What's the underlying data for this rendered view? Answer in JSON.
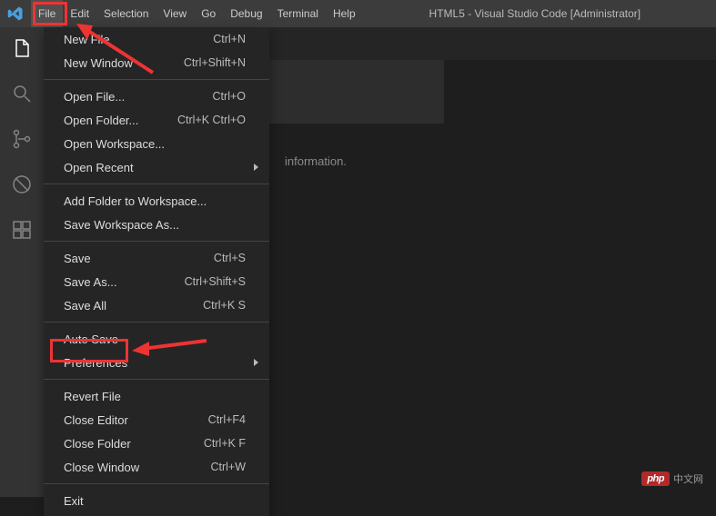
{
  "menubar": {
    "items": [
      {
        "label": "File"
      },
      {
        "label": "Edit"
      },
      {
        "label": "Selection"
      },
      {
        "label": "View"
      },
      {
        "label": "Go"
      },
      {
        "label": "Debug"
      },
      {
        "label": "Terminal"
      },
      {
        "label": "Help"
      }
    ],
    "title": "HTML5 - Visual Studio Code [Administrator]"
  },
  "dropdown": {
    "groups": [
      [
        {
          "label": "New File",
          "kbd": "Ctrl+N"
        },
        {
          "label": "New Window",
          "kbd": "Ctrl+Shift+N"
        }
      ],
      [
        {
          "label": "Open File...",
          "kbd": "Ctrl+O"
        },
        {
          "label": "Open Folder...",
          "kbd": "Ctrl+K Ctrl+O"
        },
        {
          "label": "Open Workspace..."
        },
        {
          "label": "Open Recent",
          "submenu": true
        }
      ],
      [
        {
          "label": "Add Folder to Workspace..."
        },
        {
          "label": "Save Workspace As..."
        }
      ],
      [
        {
          "label": "Save",
          "kbd": "Ctrl+S"
        },
        {
          "label": "Save As...",
          "kbd": "Ctrl+Shift+S"
        },
        {
          "label": "Save All",
          "kbd": "Ctrl+K S"
        }
      ],
      [
        {
          "label": "Auto Save"
        },
        {
          "label": "Preferences",
          "submenu": true
        }
      ],
      [
        {
          "label": "Revert File"
        },
        {
          "label": "Close Editor",
          "kbd": "Ctrl+F4"
        },
        {
          "label": "Close Folder",
          "kbd": "Ctrl+K F"
        },
        {
          "label": "Close Window",
          "kbd": "Ctrl+W"
        }
      ],
      [
        {
          "label": "Exit"
        }
      ]
    ]
  },
  "editor": {
    "info": "information."
  },
  "watermark": {
    "badge": "php",
    "cn": "中文网"
  }
}
